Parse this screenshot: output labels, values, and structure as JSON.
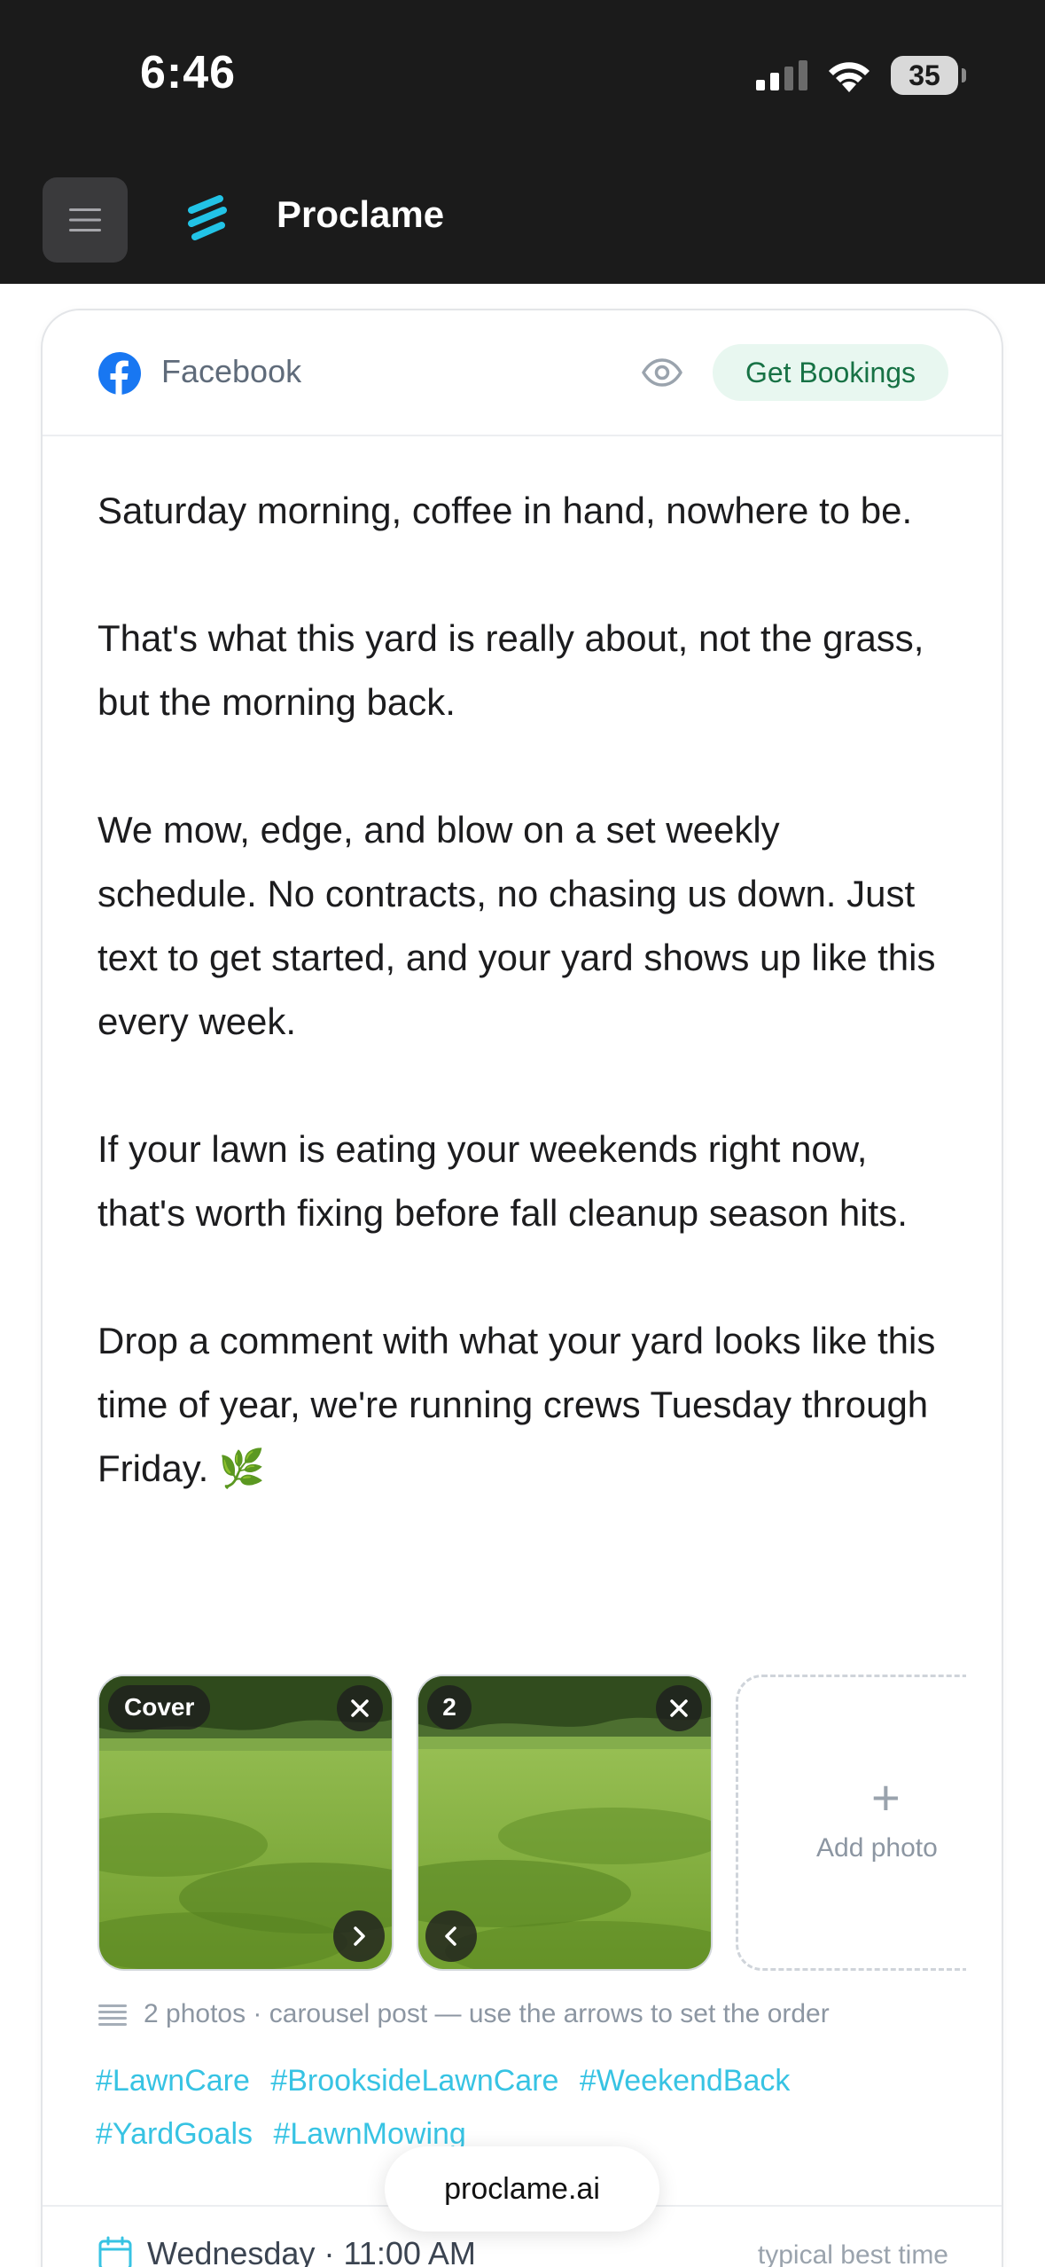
{
  "status_bar": {
    "time": "6:46",
    "battery": "35",
    "icons": [
      "cellular-signal-icon",
      "wifi-icon",
      "battery-icon"
    ]
  },
  "header": {
    "menu_icon": "hamburger-menu-icon",
    "app_name": "Proclame",
    "logo_icon": "proclame-logo-icon",
    "accent_color": "#22c3e6"
  },
  "post": {
    "platform": "Facebook",
    "platform_icon": "facebook-icon",
    "preview_icon": "eye-icon",
    "goal_badge": "Get Bookings",
    "paragraphs": [
      "Saturday morning, coffee in hand, nowhere to be.",
      "That's what this yard is really about, not the grass, but the morning back.",
      "We mow, edge, and blow on a set weekly schedule. No contracts, no chasing us down. Just text to get started, and your yard shows up like this every week.",
      "If your lawn is eating your weekends right now, that's worth fixing before fall cleanup season hits.",
      "Drop a comment with what your yard looks like this time of year, we're running crews Tuesday through Friday. 🌿"
    ],
    "photos": [
      {
        "label": "Cover",
        "remove_icon": "close-icon",
        "arrow_icon": "chevron-right-icon"
      },
      {
        "label": "2",
        "remove_icon": "close-icon",
        "arrow_icon": "chevron-left-icon"
      }
    ],
    "add_photo": {
      "icon": "plus-icon",
      "label": "Add photo"
    },
    "photo_note": "2 photos · carousel post — use the arrows to set the order",
    "hashtags": [
      "#LawnCare",
      "#BrooksideLawnCare",
      "#WeekendBack",
      "#YardGoals",
      "#LawnMowing"
    ],
    "hashtag_color": "#37c3e3",
    "schedule": {
      "icon": "calendar-icon",
      "label": "Wednesday · 11:00 AM",
      "hint": "typical best time"
    }
  },
  "footer": {
    "url": "proclame.ai"
  }
}
